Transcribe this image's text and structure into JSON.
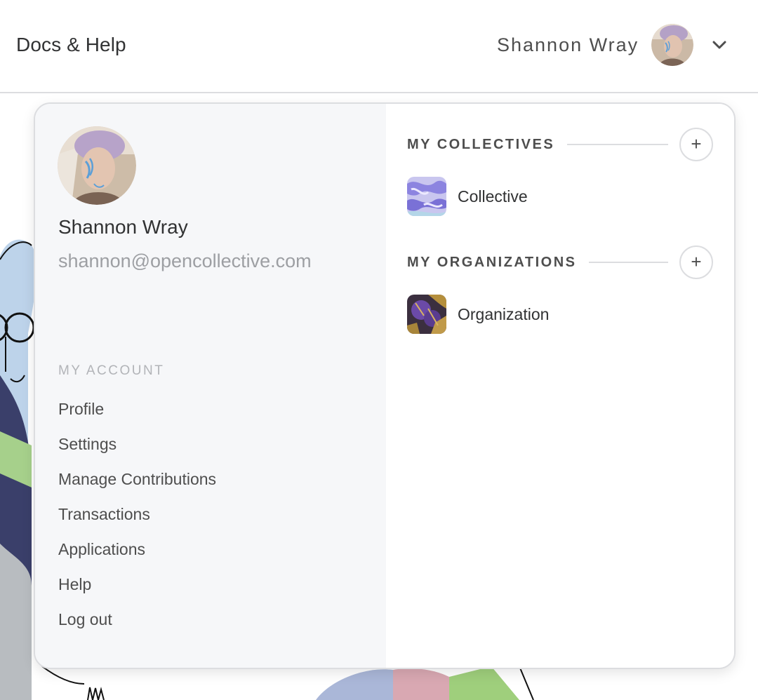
{
  "header": {
    "docs_label": "Docs & Help",
    "user_name": "Shannon Wray"
  },
  "menu": {
    "profile": {
      "name": "Shannon Wray",
      "email": "shannon@opencollective.com"
    },
    "account": {
      "heading": "MY ACCOUNT",
      "items": [
        {
          "label": "Profile"
        },
        {
          "label": "Settings"
        },
        {
          "label": "Manage Contributions"
        },
        {
          "label": "Transactions"
        },
        {
          "label": "Applications"
        },
        {
          "label": "Help"
        },
        {
          "label": "Log out"
        }
      ]
    },
    "collectives": {
      "heading": "MY COLLECTIVES",
      "add_symbol": "+",
      "items": [
        {
          "label": "Collective"
        }
      ]
    },
    "organizations": {
      "heading": "MY ORGANIZATIONS",
      "add_symbol": "+",
      "items": [
        {
          "label": "Organization"
        }
      ]
    }
  },
  "icons": {
    "dropdown": "chevron-down-icon",
    "add": "plus-icon"
  },
  "colors": {
    "left_panel_bg": "#f6f7f9",
    "border": "#dcdde0",
    "text_primary": "#313233",
    "text_muted": "#9d9fa3"
  }
}
